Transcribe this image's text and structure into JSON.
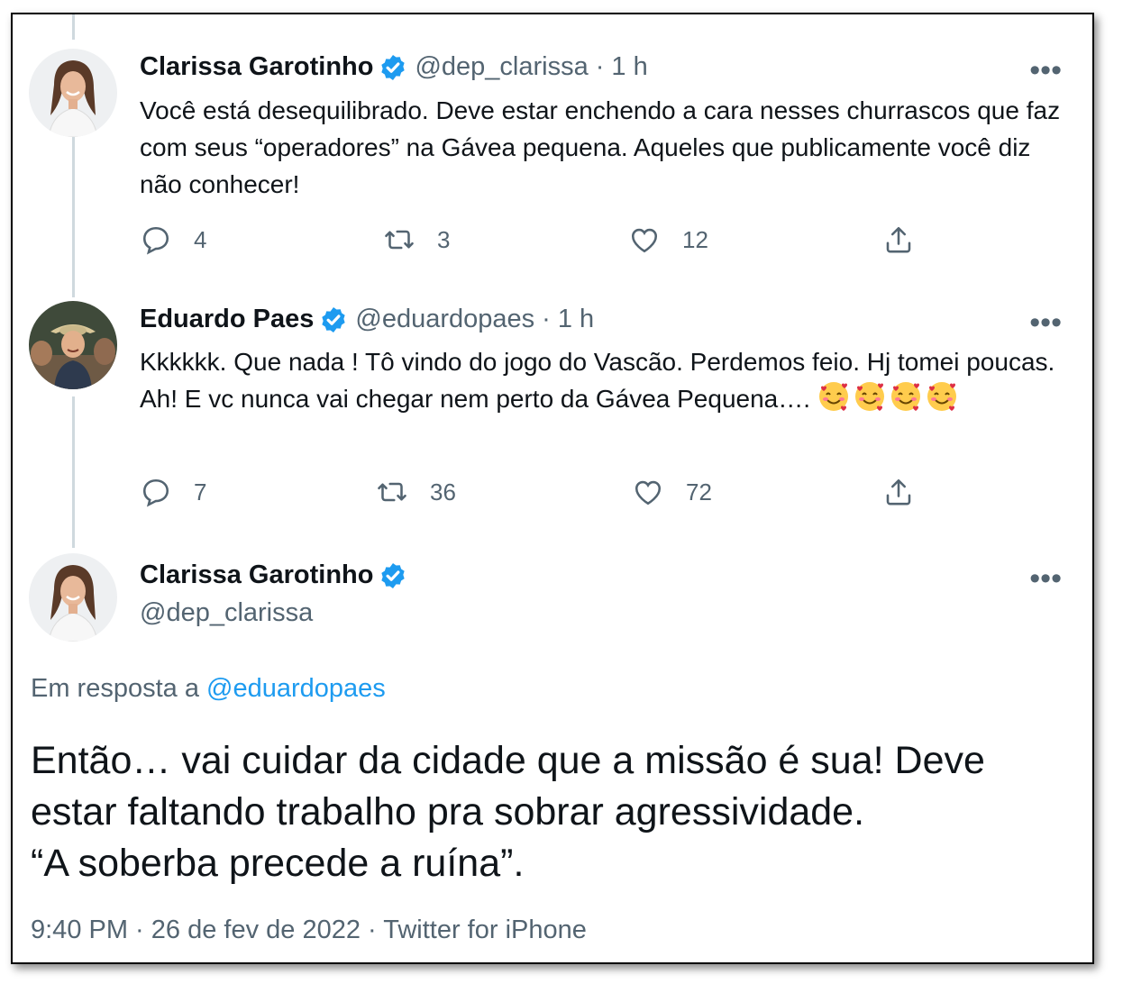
{
  "tweets": [
    {
      "name": "Clarissa Garotinho",
      "handle": "@dep_clarissa",
      "separator": "·",
      "time": "1 h",
      "more": "•••",
      "text": "Você está desequilibrado. Deve estar enchendo a cara nesses churrascos que faz com seus “operadores” na Gávea pequena. Aqueles que publicamente você diz não conhecer!",
      "replies": "4",
      "retweets": "3",
      "likes": "12"
    },
    {
      "name": "Eduardo Paes",
      "handle": "@eduardopaes",
      "separator": "·",
      "time": "1 h",
      "more": "•••",
      "text": "Kkkkkk.  Que nada !  Tô vindo do jogo do Vascão.  Perdemos feio.  Hj tomei poucas.  Ah!  E vc nunca vai chegar nem perto da Gávea Pequena…. ",
      "emojis": [
        "smiling-face-with-hearts-emoji",
        "smiling-face-with-hearts-emoji",
        "smiling-face-with-hearts-emoji",
        "smiling-face-with-hearts-emoji"
      ],
      "replies": "7",
      "retweets": "36",
      "likes": "72"
    }
  ],
  "main_tweet": {
    "name": "Clarissa Garotinho",
    "handle": "@dep_clarissa",
    "more": "•••",
    "reply_prefix": "Em resposta a",
    "reply_mention": "@eduardopaes",
    "text_lines": [
      "Então… vai cuidar da cidade que a missão é sua! Deve",
      "estar faltando trabalho pra sobrar agressividade.",
      "“A soberba precede a ruína”."
    ],
    "meta": "9:40 PM · 26 de fev de 2022 · Twitter for iPhone"
  },
  "colors": {
    "verified": "#1d9bf0",
    "secondary_text": "#536471",
    "primary_text": "#0f1419",
    "thread_line": "#cfd9de"
  },
  "icons": [
    "verified-badge-icon",
    "reply-icon",
    "retweet-icon",
    "like-icon",
    "share-icon",
    "more-icon"
  ]
}
